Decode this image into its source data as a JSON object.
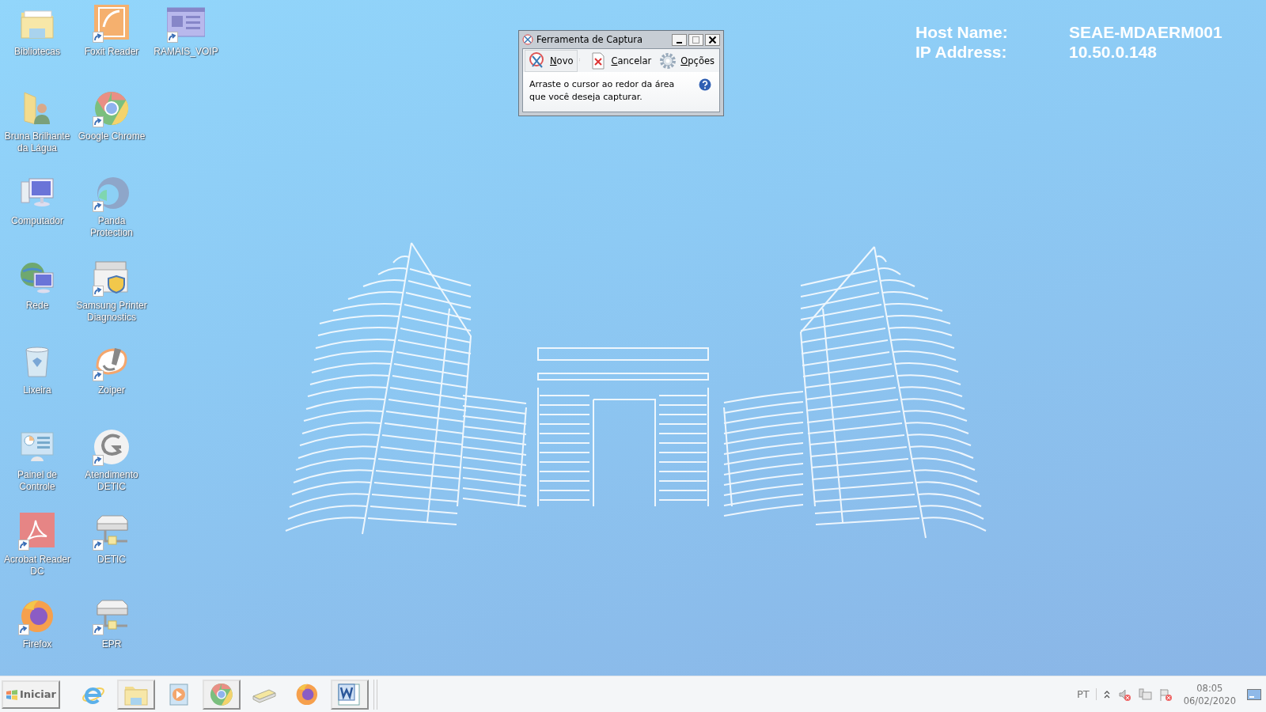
{
  "desktop_icons": [
    {
      "label": "Bibliotecas",
      "kind": "folder",
      "shortcut": false
    },
    {
      "label": "Bruna Brilhante da Lágua",
      "kind": "user-folder",
      "shortcut": false
    },
    {
      "label": "Computador",
      "kind": "computer",
      "shortcut": false
    },
    {
      "label": "Rede",
      "kind": "network",
      "shortcut": false
    },
    {
      "label": "Lixeira",
      "kind": "trash",
      "shortcut": false
    },
    {
      "label": "Painel de Controle",
      "kind": "control-panel",
      "shortcut": false
    },
    {
      "label": "Acrobat Reader DC",
      "kind": "acrobat",
      "shortcut": true
    },
    {
      "label": "Firefox",
      "kind": "firefox",
      "shortcut": true
    },
    {
      "label": "Foxit Reader",
      "kind": "foxit",
      "shortcut": true
    },
    {
      "label": "Google Chrome",
      "kind": "chrome",
      "shortcut": true
    },
    {
      "label": "Panda Protection",
      "kind": "panda",
      "shortcut": true
    },
    {
      "label": "Samsung Printer Diagnostics",
      "kind": "printer",
      "shortcut": true
    },
    {
      "label": "Zoiper",
      "kind": "zoiper",
      "shortcut": true
    },
    {
      "label": "Atendimento DETIC",
      "kind": "swirl",
      "shortcut": true
    },
    {
      "label": "DETIC",
      "kind": "drive",
      "shortcut": true
    },
    {
      "label": "EPR",
      "kind": "drive",
      "shortcut": true
    },
    {
      "label": "RAMAIS_VOIP",
      "kind": "window",
      "shortcut": true
    }
  ],
  "snipping_window": {
    "title": "Ferramenta de Captura",
    "toolbar": [
      {
        "label": "Novo",
        "kind": "new"
      },
      {
        "label": "Cancelar",
        "kind": "cancel"
      },
      {
        "label": "Opções",
        "kind": "options"
      }
    ],
    "message": "Arraste o cursor ao redor da área que você deseja capturar."
  },
  "system_info": [
    {
      "label": "Host Name:",
      "value": "SEAE-MDAERM001"
    },
    {
      "label": "IP Address:",
      "value": "10.50.0.148"
    }
  ],
  "taskbar": {
    "start_label": "Iniciar",
    "apps": [
      {
        "kind": "ie",
        "running": false
      },
      {
        "kind": "folder",
        "running": true
      },
      {
        "kind": "media",
        "running": false
      },
      {
        "kind": "chrome",
        "running": true
      },
      {
        "kind": "scanner",
        "running": false
      },
      {
        "kind": "firefox",
        "running": false
      },
      {
        "kind": "word",
        "running": true
      }
    ],
    "language": "PT",
    "tray": [
      {
        "kind": "speaker"
      },
      {
        "kind": "network"
      },
      {
        "kind": "flag"
      }
    ],
    "time": "08:05",
    "date": "06/02/2020"
  }
}
